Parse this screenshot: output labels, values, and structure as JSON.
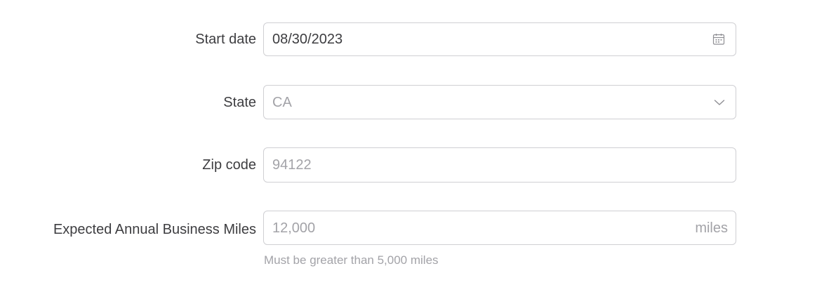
{
  "form": {
    "start_date": {
      "label": "Start date",
      "value": "08/30/2023",
      "icon": "calendar-icon"
    },
    "state": {
      "label": "State",
      "value": "CA",
      "icon": "chevron-down-icon"
    },
    "zip_code": {
      "label": "Zip code",
      "placeholder": "94122"
    },
    "annual_miles": {
      "label": "Expected Annual Business Miles",
      "placeholder": "12,000",
      "suffix": "miles",
      "help": "Must be greater than 5,000 miles"
    }
  },
  "colors": {
    "label_text": "#3d3d40",
    "placeholder_text": "#a3a3a8",
    "border": "#cfcfd3"
  }
}
